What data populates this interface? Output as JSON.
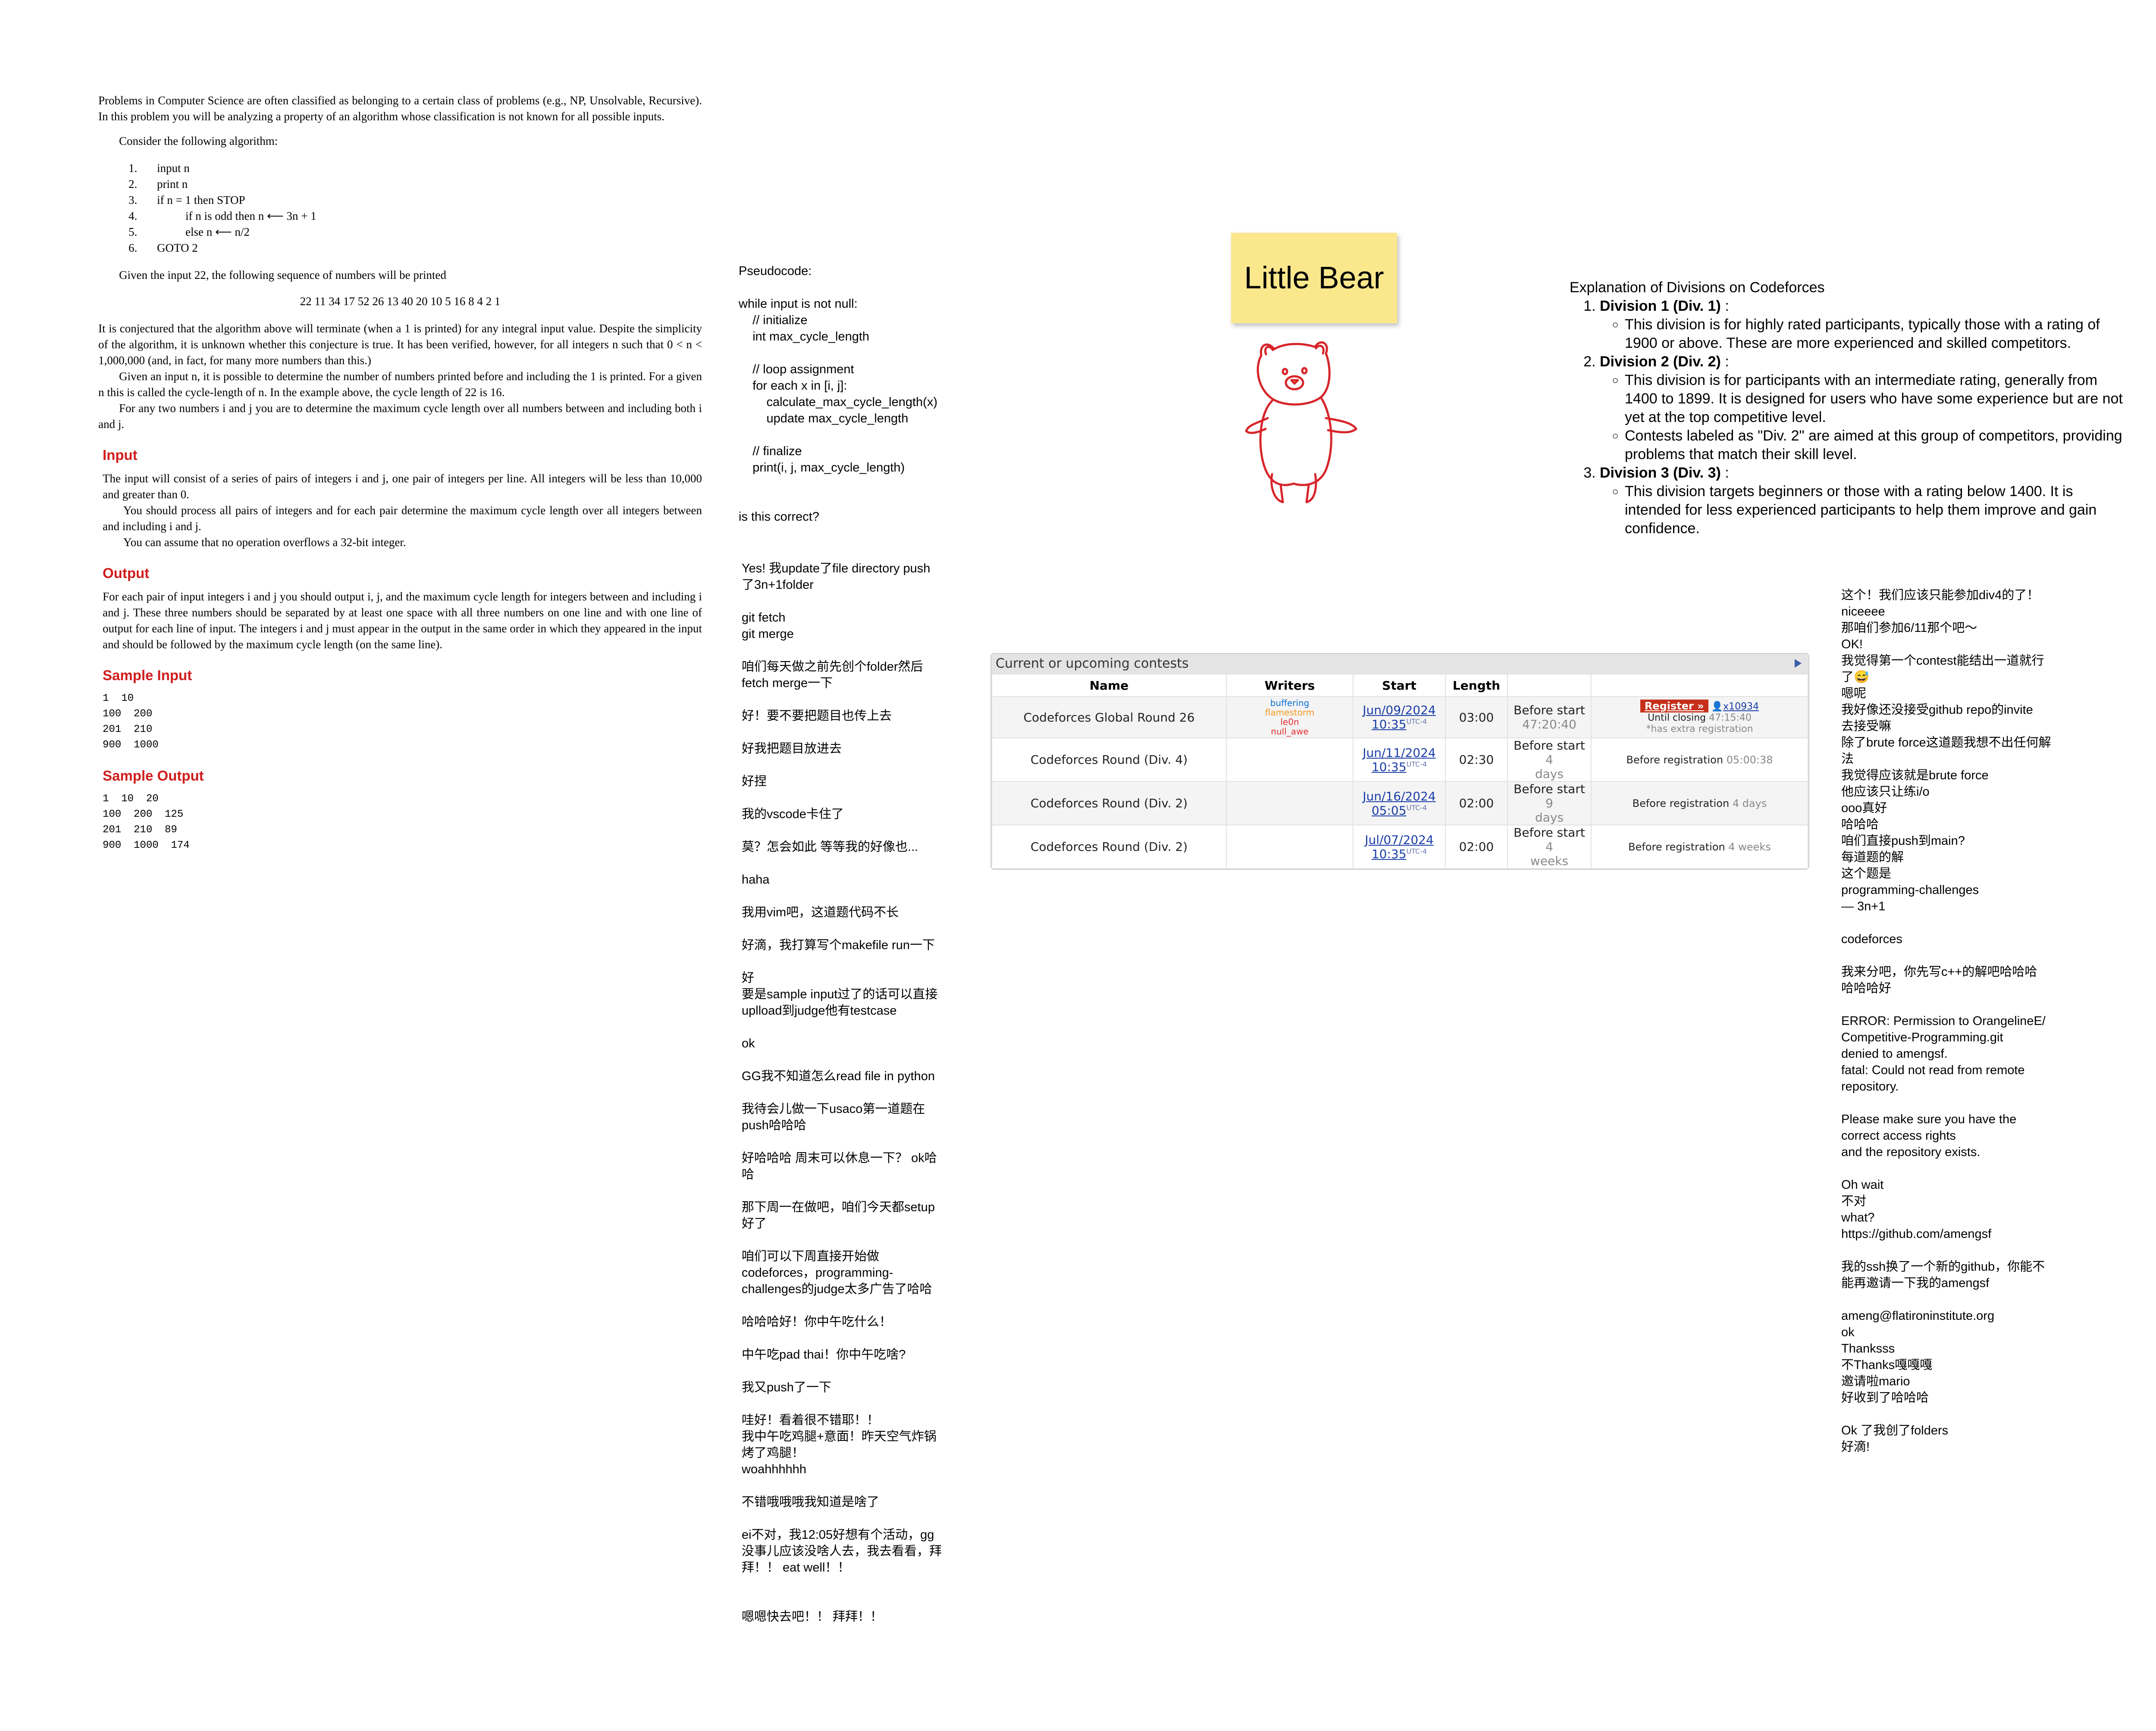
{
  "problem": {
    "intro": "Problems in Computer Science are often classified as belonging to a certain class of problems (e.g., NP, Unsolvable, Recursive). In this problem you will be analyzing a property of an algorithm whose classification is not known for all possible inputs.",
    "consider": "Consider the following algorithm:",
    "algorithm": [
      {
        "num": "1.",
        "text": "input n"
      },
      {
        "num": "2.",
        "text": "print n"
      },
      {
        "num": "3.",
        "text": "if n = 1 then STOP"
      },
      {
        "num": "4.",
        "text": "if n is odd then n ⟵ 3n + 1",
        "sub": true
      },
      {
        "num": "5.",
        "text": "else n ⟵ n/2",
        "sub": true
      },
      {
        "num": "6.",
        "text": "GOTO 2"
      }
    ],
    "given": "Given the input 22, the following sequence of numbers will be printed",
    "sequence": "22 11 34 17 52 26 13 40 20 10 5 16 8 4 2 1",
    "conjecture": "It is conjectured that the algorithm above will terminate (when a 1 is printed) for any integral input value. Despite the simplicity of the algorithm, it is unknown whether this conjecture is true. It has been verified, however, for all integers n such that 0 < n < 1,000,000 (and, in fact, for many more numbers than this.)",
    "cycle": "Given an input n, it is possible to determine the number of numbers printed before and including the 1 is printed. For a given n this is called the cycle-length of n. In the example above, the cycle length of 22 is 16.",
    "task": "For any two numbers i and j you are to determine the maximum cycle length over all numbers between and including both i and j.",
    "input_heading": "Input",
    "input_1": "The input will consist of a series of pairs of integers i and j, one pair of integers per line. All integers will be less than 10,000 and greater than 0.",
    "input_2": "You should process all pairs of integers and for each pair determine the maximum cycle length over all integers between and including i and j.",
    "input_3": "You can assume that no operation overflows a 32-bit integer.",
    "output_heading": "Output",
    "output_1": "For each pair of input integers i and j you should output i, j, and the maximum cycle length for integers between and including i and j. These three numbers should be separated by at least one space with all three numbers on one line and with one line of output for each line of input. The integers i and j must appear in the output in the same order in which they appeared in the input and should be followed by the maximum cycle length (on the same line).",
    "sample_input_heading": "Sample Input",
    "sample_input": "1  10\n100  200\n201  210\n900  1000",
    "sample_output_heading": "Sample Output",
    "sample_output": "1  10  20\n100  200  125\n201  210  89\n900  1000  174"
  },
  "pseudocode": "Pseudocode:\n\nwhile input is not null:\n    // initialize\n    int max_cycle_length\n\n    // loop assignment\n    for each x in [i, j]:\n        calculate_max_cycle_length(x)\n        update max_cycle_length\n\n    // finalize\n    print(i, j, max_cycle_length)\n\n\nis this correct?",
  "chat_middle": "Yes! 我update了file directory push\n了3n+1folder\n\ngit fetch\ngit merge\n\n咱们每天做之前先创个folder然后\nfetch merge一下\n\n好！要不要把题目也传上去\n\n好我把题目放进去\n\n好捏\n\n我的vscode卡住了\n\n莫？怎会如此 等等我的好像也...\n\nhaha\n\n我用vim吧，这道题代码不长\n\n好滴，我打算写个makefile run一下\n\n好\n要是sample input过了的话可以直接\nuplload到judge他有testcase\n\nok\n\nGG我不知道怎么read file in python\n\n我待会儿做一下usaco第一道题在\npush哈哈哈\n\n好哈哈哈 周末可以休息一下？ ok哈\n哈\n\n那下周一在做吧，咱们今天都setup\n好了\n\n咱们可以下周直接开始做\ncodeforces，programming-\nchallenges的judge太多广告了哈哈\n\n哈哈哈好！你中午吃什么！\n\n中午吃pad thai！你中午吃啥?\n\n我又push了一下\n\n哇好！看着很不错耶！！\n我中午吃鸡腿+意面！昨天空气炸锅\n烤了鸡腿！\nwoahhhhhh\n\n不错哦哦哦我知道是啥了\n\nei不对，我12:05好想有个活动，gg\n没事儿应该没啥人去，我去看看，拜\n拜！！ eat well！！\n\n\n嗯嗯快去吧！！ 拜拜！！",
  "sticky": "Little Bear",
  "divisions": {
    "title": "Explanation of Divisions on Codeforces",
    "items": [
      {
        "label": "Division 1 (Div. 1)",
        "bullets": [
          "This division is for highly rated participants, typically those with a rating of 1900 or above. These are more experienced and skilled competitors."
        ]
      },
      {
        "label": "Division 2 (Div. 2)",
        "bullets": [
          "This division is for participants with an intermediate rating, generally from 1400 to 1899. It is designed for users who have some experience but are not yet at the top competitive level.",
          "Contests labeled as \"Div. 2\" are aimed at this group of competitors, providing problems that match their skill level."
        ]
      },
      {
        "label": "Division 3 (Div. 3)",
        "bullets": [
          "This division targets beginners or those with a rating below 1400. It is intended for less experienced participants to help them improve and gain confidence."
        ]
      }
    ]
  },
  "contests": {
    "caption": "Current or upcoming contests",
    "headers": [
      "Name",
      "Writers",
      "Start",
      "Length",
      "",
      ""
    ],
    "rows": [
      {
        "name": "Codeforces Global Round 26",
        "writers": [
          "buffering",
          "flamestorm",
          "le0n",
          "null_awe"
        ],
        "date": "Jun/09/2024",
        "time": "10:35",
        "utc": "UTC-4",
        "length": "03:00",
        "before": "Before start",
        "countdown": "47:20:40",
        "register": "Register »",
        "user": "x10934",
        "closing": "Until closing",
        "closing_time": "47:15:40",
        "extra": "*has extra registration"
      },
      {
        "name": "Codeforces Round (Div. 4)",
        "date": "Jun/11/2024",
        "time": "10:35",
        "utc": "UTC-4",
        "length": "02:30",
        "before": "Before start",
        "before_val": "4",
        "before_unit": "days",
        "reg": "Before registration",
        "reg_val": "05:00:38"
      },
      {
        "name": "Codeforces Round (Div. 2)",
        "date": "Jun/16/2024",
        "time": "05:05",
        "utc": "UTC-4",
        "length": "02:00",
        "before": "Before start",
        "before_val": "9",
        "before_unit": "days",
        "reg": "Before registration",
        "reg_val": "4 days"
      },
      {
        "name": "Codeforces Round (Div. 2)",
        "date": "Jul/07/2024",
        "time": "10:35",
        "utc": "UTC-4",
        "length": "02:00",
        "before": "Before start",
        "before_val": "4",
        "before_unit": "weeks",
        "reg": "Before registration",
        "reg_val": "4 weeks"
      }
    ]
  },
  "chat_right": "这个！我们应该只能参加div4的了！\nniceeee\n那咱们参加6/11那个吧～\nOK!\n我觉得第一个contest能结出一道就行\n了😅\n嗯呢\n我好像还没接受github repo的invite\n去接受嘛\n除了brute force这道题我想不出任何解\n法\n我觉得应该就是brute force\n他应该只让练i/o\nooo真好\n哈哈哈\n咱们直接push到main?\n每道题的解\n这个题是\nprogramming-challenges\n— 3n+1\n\ncodeforces\n\n我来分吧，你先写c++的解吧哈哈哈\n哈哈哈好\n\nERROR: Permission to OrangelineE/\nCompetitive-Programming.git\ndenied to amengsf.\nfatal: Could not read from remote\nrepository.\n\nPlease make sure you have the\ncorrect access rights\nand the repository exists.\n\nOh wait\n不对\nwhat?\nhttps://github.com/amengsf\n\n我的ssh换了一个新的github，你能不\n能再邀请一下我的amengsf\n\nameng@flatironinstitute.org\nok\nThanksss\n不Thanks嘎嘎嘎\n邀请啦mario\n好收到了哈哈哈\n\nOk 了我创了folders\n好滴!"
}
